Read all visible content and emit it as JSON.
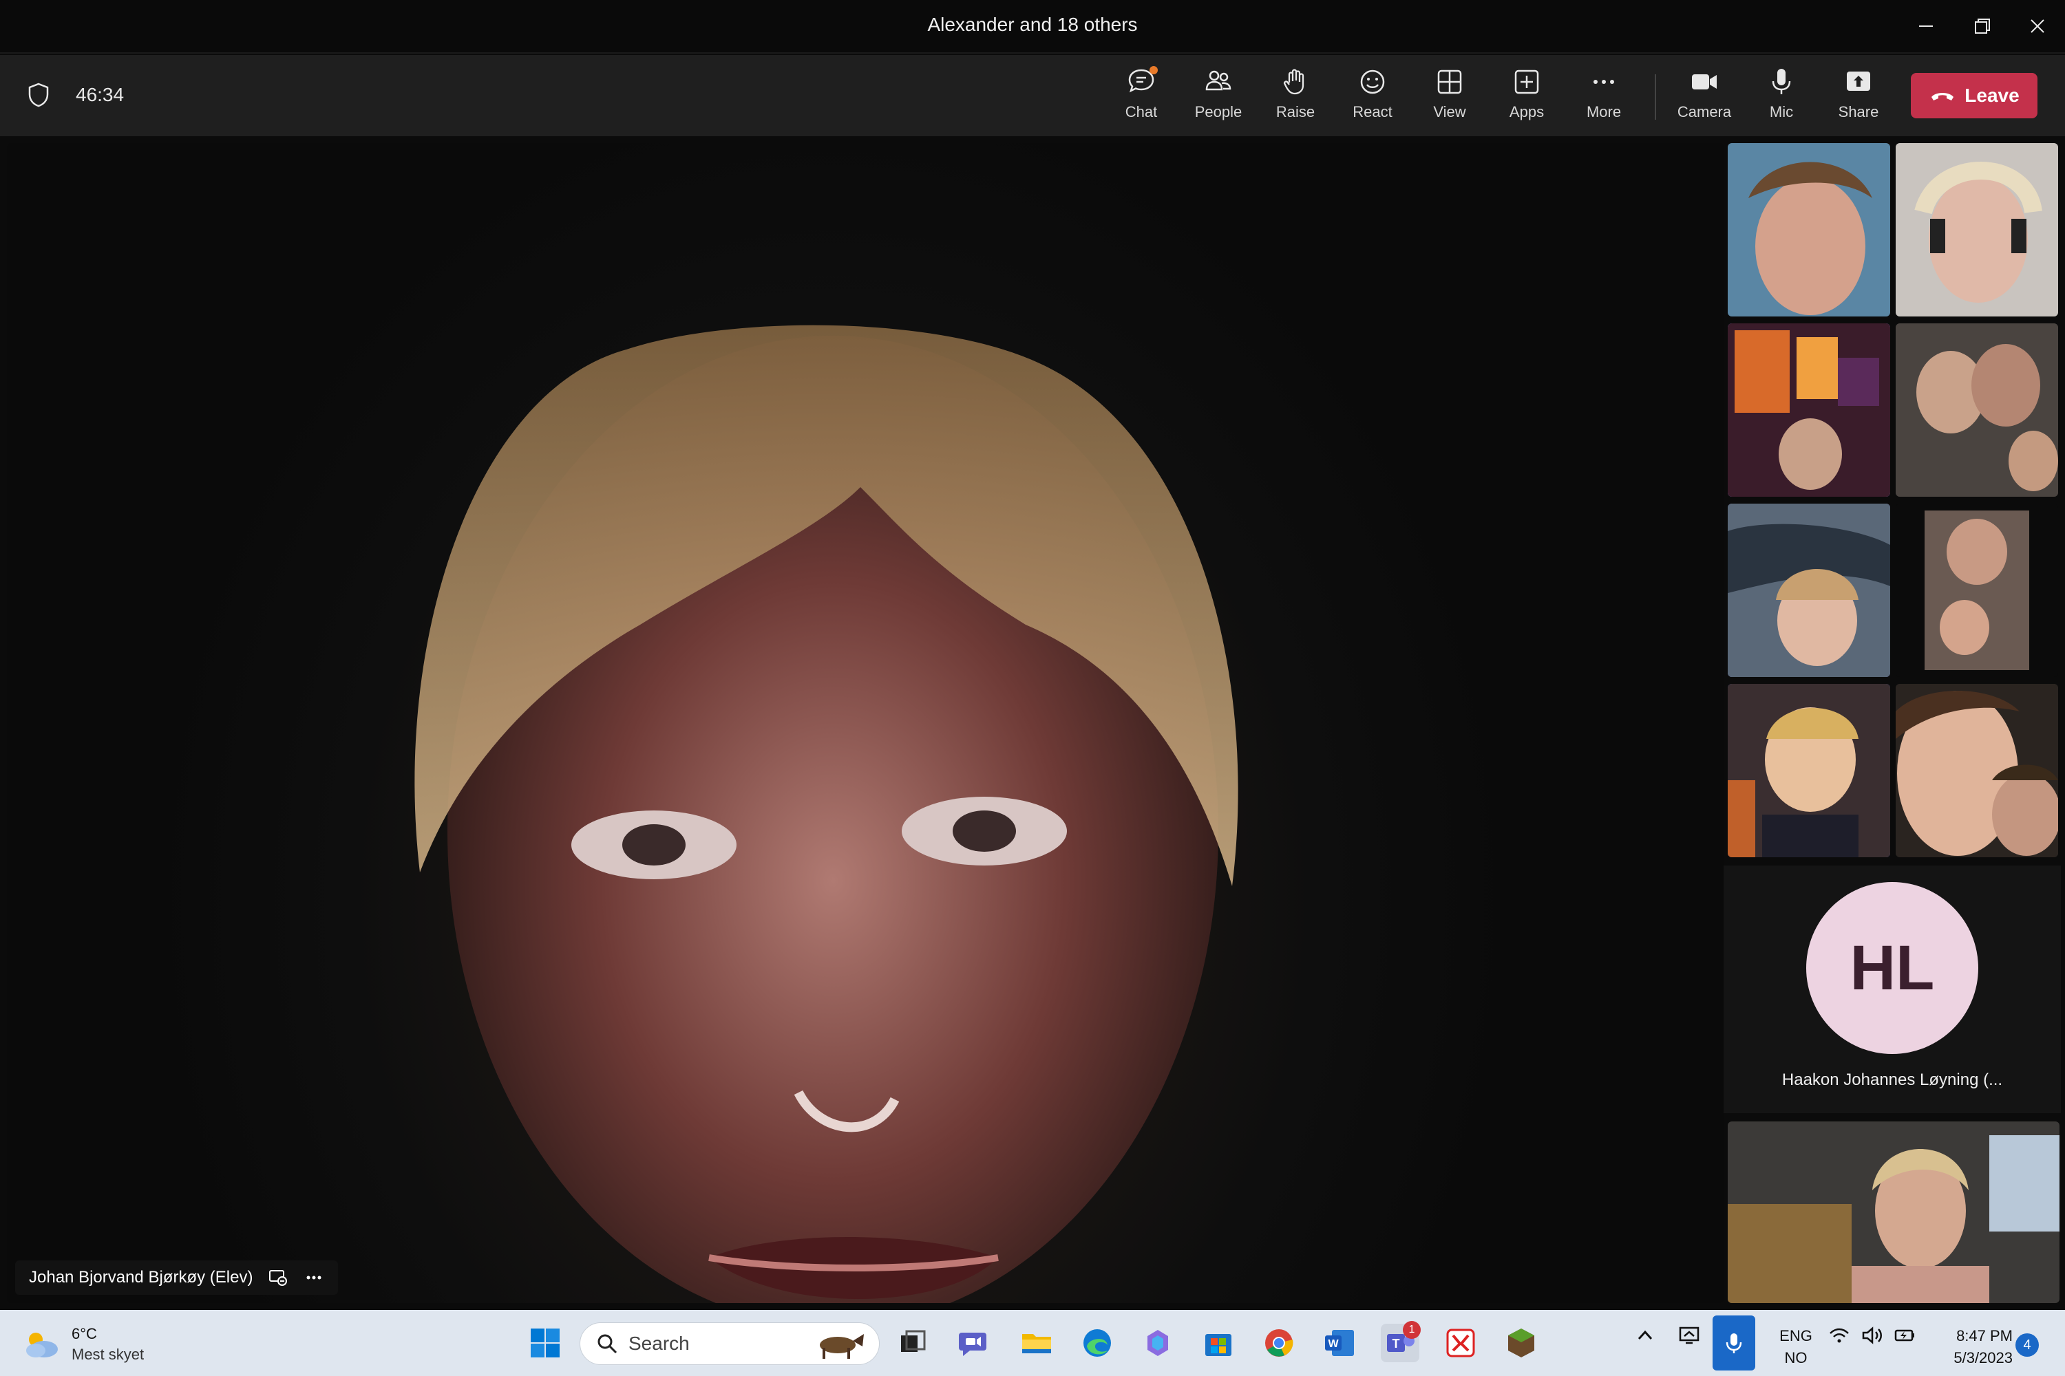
{
  "window": {
    "title": "Alexander and 18 others"
  },
  "toolbar": {
    "timer": "46:34",
    "buttons": [
      {
        "label": "Chat",
        "icon": "chat-icon"
      },
      {
        "label": "People",
        "icon": "people-icon"
      },
      {
        "label": "Raise",
        "icon": "raise-hand-icon"
      },
      {
        "label": "React",
        "icon": "react-icon"
      },
      {
        "label": "View",
        "icon": "view-icon"
      },
      {
        "label": "Apps",
        "icon": "apps-icon"
      },
      {
        "label": "More",
        "icon": "more-icon"
      },
      {
        "label": "Camera",
        "icon": "camera-icon"
      },
      {
        "label": "Mic",
        "icon": "mic-icon"
      },
      {
        "label": "Share",
        "icon": "share-icon"
      }
    ],
    "leave_label": "Leave"
  },
  "stage": {
    "speaker_name": "Johan Bjorvand Bjørkøy (Elev)"
  },
  "participants": {
    "avatar_initials": "HL",
    "avatar_name": "Haakon Johannes Løyning (..."
  },
  "taskbar": {
    "weather_temp": "6°C",
    "weather_desc": "Mest skyet",
    "search_placeholder": "Search",
    "lang_top": "ENG",
    "lang_bottom": "NO",
    "time": "8:47 PM",
    "date": "5/3/2023",
    "notification_count": "4",
    "teams_badge": "1"
  },
  "colors": {
    "accent": "#7f85f5",
    "leave": "#c4314b",
    "taskbar": "#dfe6ef",
    "avatar_bg": "#edd3e1"
  }
}
